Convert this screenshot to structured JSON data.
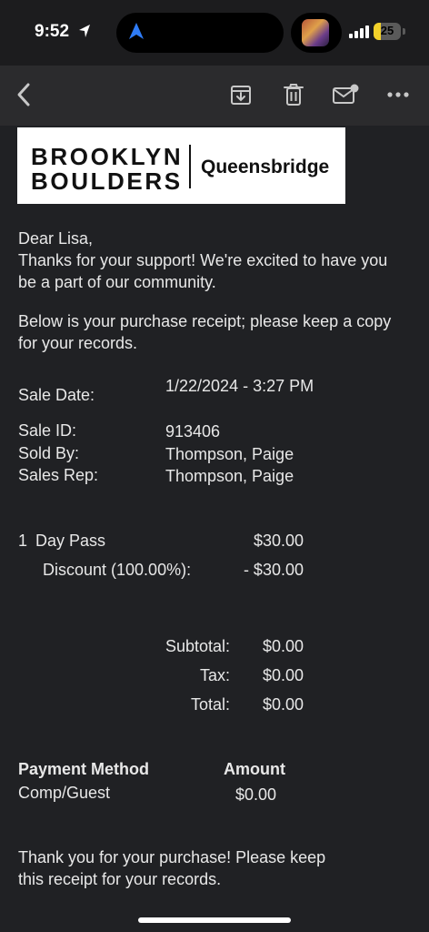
{
  "status_bar": {
    "time": "9:52",
    "battery_percent": "25",
    "battery_level": 0.25,
    "battery_color": "#f4d22a"
  },
  "toolbar": {
    "back_icon": "chevron-left-icon",
    "archive_icon": "archive-icon",
    "trash_icon": "trash-icon",
    "mark_unread_icon": "envelope-badge-icon",
    "more_icon": "ellipsis-icon"
  },
  "logo": {
    "line1": "BROOKLYN",
    "line2": "BOULDERS",
    "location": "Queensbridge"
  },
  "email": {
    "greeting": "Dear Lisa,",
    "intro": "Thanks for your support! We're excited to have you be a part of our community.",
    "receipt_note": "Below is your purchase receipt; please keep a copy for your records.",
    "details": [
      {
        "label": "Sale Date:",
        "value": "1/22/2024 - 3:27 PM"
      },
      {
        "label": "Sale ID:",
        "value": "913406"
      },
      {
        "label": "Sold By:",
        "value": "Thompson, Paige"
      },
      {
        "label": "Sales Rep:",
        "value": "Thompson, Paige"
      }
    ],
    "line_items": [
      {
        "qty": "1",
        "name": "Day Pass",
        "amount": "$30.00"
      },
      {
        "name": "Discount (100.00%):",
        "amount": "- $30.00"
      }
    ],
    "totals": [
      {
        "label": "Subtotal:",
        "value": "$0.00"
      },
      {
        "label": "Tax:",
        "value": "$0.00"
      },
      {
        "label": "Total:",
        "value": "$0.00"
      }
    ],
    "payment": {
      "method_header": "Payment Method",
      "amount_header": "Amount",
      "method": "Comp/Guest",
      "amount": "$0.00"
    },
    "closing": "Thank you for your purchase! Please keep this receipt for your records."
  }
}
